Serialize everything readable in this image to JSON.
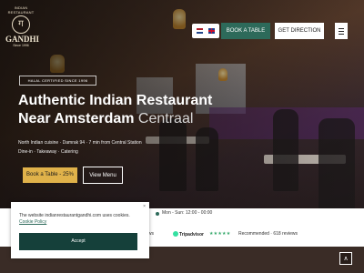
{
  "brand": {
    "arc_text": "INDIAN RESTAURANT",
    "name": "GANDHI",
    "since": "Since 1996",
    "mark": "ग"
  },
  "nav": {
    "languages": [
      "nl",
      "en"
    ],
    "book_table": "BOOK A TABLE",
    "get_direction": "GET DIRECTION",
    "menu_icon": "hamburger-icon"
  },
  "hero": {
    "badge": "HALAL CERTIFIED SINCE 1996",
    "title_line1": "Authentic Indian Restaurant",
    "title_line2_bold": "Near Amsterdam",
    "title_line2_light": "Centraal",
    "info_line1": "North Indian cuisine · Damrak 94 · 7 min from Central Station",
    "info_line2": "Dine-in · Takeaway · Catering",
    "book_button": "Book a Table - 25% Off",
    "menu_button": "View Menu"
  },
  "infobar": {
    "hours": "Mon - Sun: 12:00 - 00:00",
    "left_reviews": "iews",
    "tripadvisor": "Tripadvisor",
    "stars": "★★★★★",
    "recommended": "Recommended · 618 reviews"
  },
  "cookie": {
    "text": "The website indianrestaurantgandhi.com uses cookies.",
    "policy_link": "Cookie Policy",
    "accept": "Accept",
    "close": "×"
  },
  "scroll_top": "∧",
  "colors": {
    "accent_green": "#2d6a5a",
    "gold": "#e0b24a",
    "dark_green": "#15403a"
  }
}
